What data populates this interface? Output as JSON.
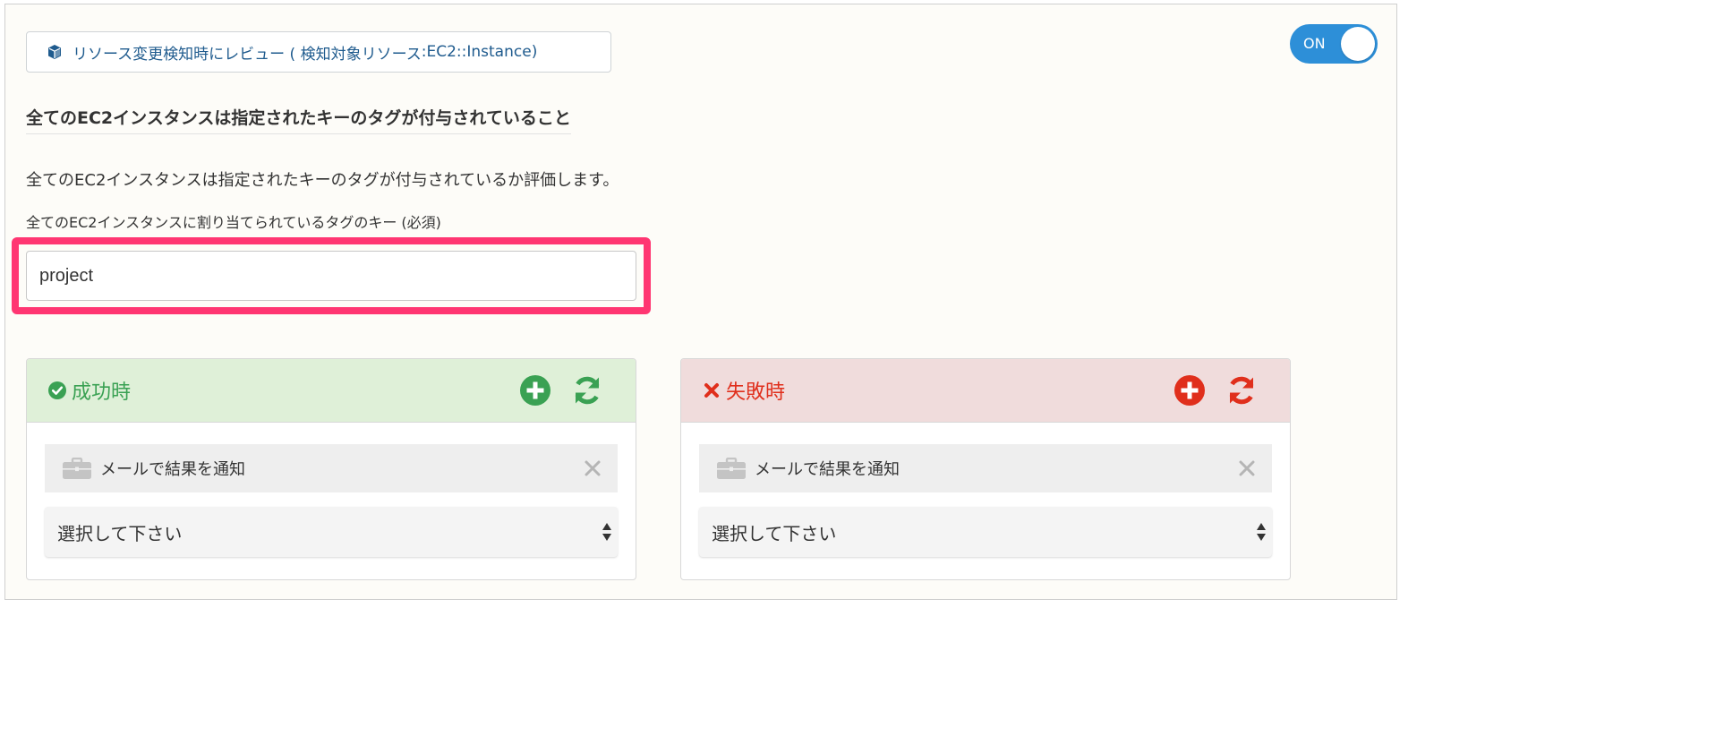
{
  "resource": {
    "label_prefix": "リソース変更検知時にレビュー ( 検知対象リソース",
    "label_sep": ": ",
    "label_resource": "EC2::Instance",
    "label_suffix": " )"
  },
  "toggle": {
    "label": "ON",
    "state": "on"
  },
  "rule": {
    "title": "全てのEC2インスタンスは指定されたキーのタグが付与されていること",
    "description": "全てのEC2インスタンスは指定されたキーのタグが付与されているか評価します。"
  },
  "tag_field": {
    "label": "全てのEC2インスタンスに割り当てられているタグのキー (必須)",
    "value": "project"
  },
  "success_panel": {
    "title": "成功時",
    "action_label": "メールで結果を通知",
    "select_value": "選択して下さい",
    "color": "#3aa153"
  },
  "failure_panel": {
    "title": "失敗時",
    "action_label": "メールで結果を通知",
    "select_value": "選択して下さい",
    "color": "#e02f1c"
  },
  "colors": {
    "highlight": "#ff3672",
    "toggle_on": "#2d8fd8",
    "link_blue": "#1f5b8e"
  },
  "icons": {
    "resource": "cube-icon",
    "success": "check-circle-icon",
    "failure": "x-icon",
    "add": "plus-circle-icon",
    "refresh": "refresh-icon",
    "action": "briefcase-icon",
    "remove": "close-icon",
    "select": "sort-arrows-icon"
  }
}
